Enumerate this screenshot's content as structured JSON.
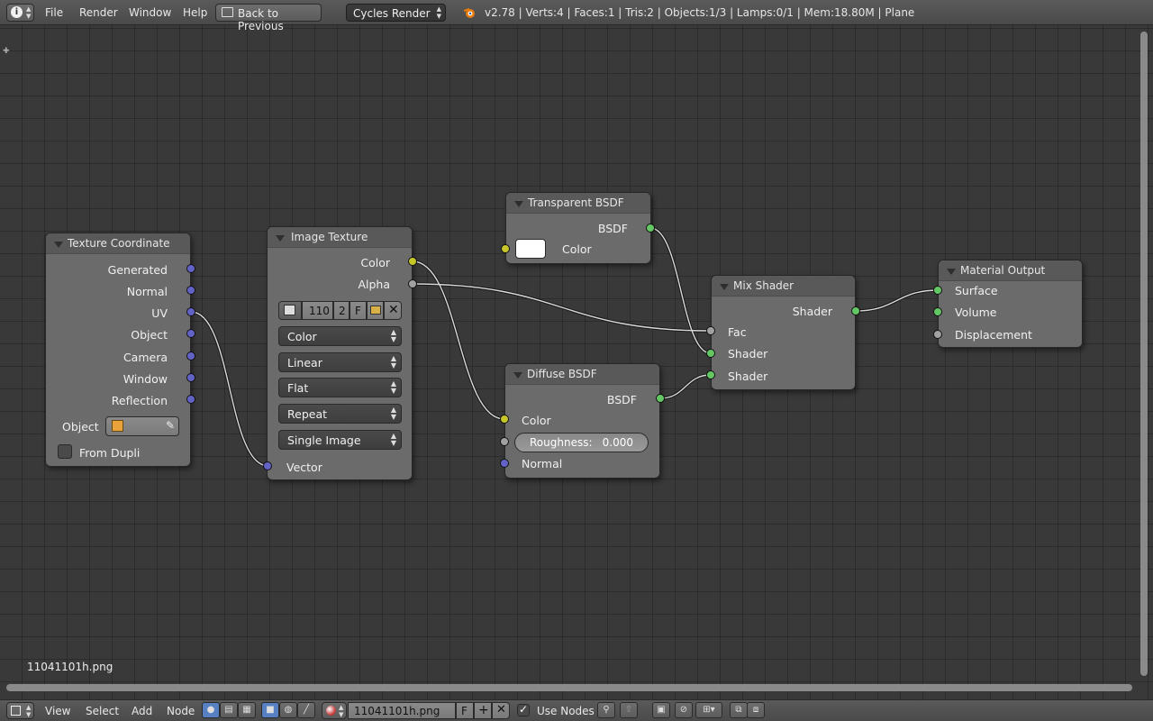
{
  "header": {
    "menus": [
      "File",
      "Render",
      "Window",
      "Help"
    ],
    "back_button": "Back to Previous",
    "render_engine": "Cycles Render",
    "stats": "v2.78 | Verts:4 | Faces:1 | Tris:2 | Objects:1/3 | Lamps:0/1 | Mem:18.80M | Plane"
  },
  "nodes": {
    "texture_coordinate": {
      "title": "Texture Coordinate",
      "outputs": [
        "Generated",
        "Normal",
        "UV",
        "Object",
        "Camera",
        "Window",
        "Reflection"
      ],
      "object_label": "Object",
      "from_dupli": "From Dupli"
    },
    "image_texture": {
      "title": "Image Texture",
      "outputs": [
        "Color",
        "Alpha"
      ],
      "image_users": "110",
      "image_num": "2",
      "fake_user": "F",
      "color_space": "Color",
      "interpolation": "Linear",
      "projection": "Flat",
      "extension": "Repeat",
      "source": "Single Image",
      "input": "Vector"
    },
    "transparent_bsdf": {
      "title": "Transparent BSDF",
      "output": "BSDF",
      "input": "Color",
      "color": "#ffffff"
    },
    "diffuse_bsdf": {
      "title": "Diffuse BSDF",
      "output": "BSDF",
      "input_color": "Color",
      "roughness_label": "Roughness:",
      "roughness_value": "0.000",
      "input_normal": "Normal"
    },
    "mix_shader": {
      "title": "Mix Shader",
      "output": "Shader",
      "inputs": [
        "Fac",
        "Shader",
        "Shader"
      ]
    },
    "material_output": {
      "title": "Material Output",
      "inputs": [
        "Surface",
        "Volume",
        "Displacement"
      ]
    }
  },
  "image_name_overlay": "11041101h.png",
  "footer": {
    "menus": [
      "View",
      "Select",
      "Add",
      "Node"
    ],
    "image_field": "11041101h.png",
    "fake_user": "F",
    "use_nodes_label": "Use Nodes"
  },
  "colors": {
    "socket_shader": "#63c763",
    "socket_color": "#c7c729",
    "socket_vector": "#6363c7",
    "socket_float": "#a1a1a1"
  }
}
